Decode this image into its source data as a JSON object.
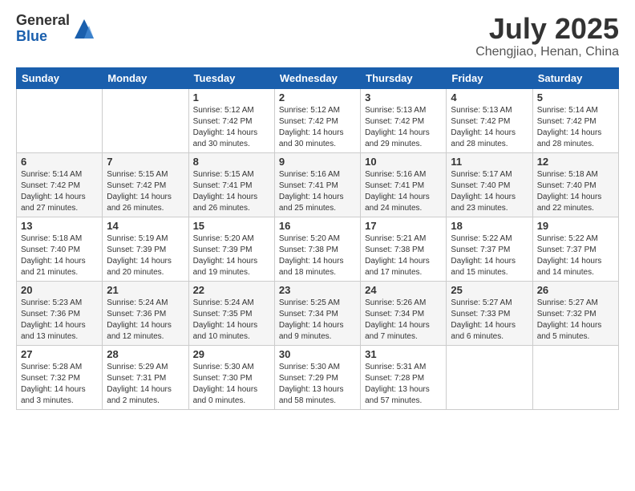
{
  "logo": {
    "general": "General",
    "blue": "Blue"
  },
  "title": "July 2025",
  "subtitle": "Chengjiao, Henan, China",
  "header_days": [
    "Sunday",
    "Monday",
    "Tuesday",
    "Wednesday",
    "Thursday",
    "Friday",
    "Saturday"
  ],
  "weeks": [
    [
      {
        "day": "",
        "info": ""
      },
      {
        "day": "",
        "info": ""
      },
      {
        "day": "1",
        "info": "Sunrise: 5:12 AM\nSunset: 7:42 PM\nDaylight: 14 hours\nand 30 minutes."
      },
      {
        "day": "2",
        "info": "Sunrise: 5:12 AM\nSunset: 7:42 PM\nDaylight: 14 hours\nand 30 minutes."
      },
      {
        "day": "3",
        "info": "Sunrise: 5:13 AM\nSunset: 7:42 PM\nDaylight: 14 hours\nand 29 minutes."
      },
      {
        "day": "4",
        "info": "Sunrise: 5:13 AM\nSunset: 7:42 PM\nDaylight: 14 hours\nand 28 minutes."
      },
      {
        "day": "5",
        "info": "Sunrise: 5:14 AM\nSunset: 7:42 PM\nDaylight: 14 hours\nand 28 minutes."
      }
    ],
    [
      {
        "day": "6",
        "info": "Sunrise: 5:14 AM\nSunset: 7:42 PM\nDaylight: 14 hours\nand 27 minutes."
      },
      {
        "day": "7",
        "info": "Sunrise: 5:15 AM\nSunset: 7:42 PM\nDaylight: 14 hours\nand 26 minutes."
      },
      {
        "day": "8",
        "info": "Sunrise: 5:15 AM\nSunset: 7:41 PM\nDaylight: 14 hours\nand 26 minutes."
      },
      {
        "day": "9",
        "info": "Sunrise: 5:16 AM\nSunset: 7:41 PM\nDaylight: 14 hours\nand 25 minutes."
      },
      {
        "day": "10",
        "info": "Sunrise: 5:16 AM\nSunset: 7:41 PM\nDaylight: 14 hours\nand 24 minutes."
      },
      {
        "day": "11",
        "info": "Sunrise: 5:17 AM\nSunset: 7:40 PM\nDaylight: 14 hours\nand 23 minutes."
      },
      {
        "day": "12",
        "info": "Sunrise: 5:18 AM\nSunset: 7:40 PM\nDaylight: 14 hours\nand 22 minutes."
      }
    ],
    [
      {
        "day": "13",
        "info": "Sunrise: 5:18 AM\nSunset: 7:40 PM\nDaylight: 14 hours\nand 21 minutes."
      },
      {
        "day": "14",
        "info": "Sunrise: 5:19 AM\nSunset: 7:39 PM\nDaylight: 14 hours\nand 20 minutes."
      },
      {
        "day": "15",
        "info": "Sunrise: 5:20 AM\nSunset: 7:39 PM\nDaylight: 14 hours\nand 19 minutes."
      },
      {
        "day": "16",
        "info": "Sunrise: 5:20 AM\nSunset: 7:38 PM\nDaylight: 14 hours\nand 18 minutes."
      },
      {
        "day": "17",
        "info": "Sunrise: 5:21 AM\nSunset: 7:38 PM\nDaylight: 14 hours\nand 17 minutes."
      },
      {
        "day": "18",
        "info": "Sunrise: 5:22 AM\nSunset: 7:37 PM\nDaylight: 14 hours\nand 15 minutes."
      },
      {
        "day": "19",
        "info": "Sunrise: 5:22 AM\nSunset: 7:37 PM\nDaylight: 14 hours\nand 14 minutes."
      }
    ],
    [
      {
        "day": "20",
        "info": "Sunrise: 5:23 AM\nSunset: 7:36 PM\nDaylight: 14 hours\nand 13 minutes."
      },
      {
        "day": "21",
        "info": "Sunrise: 5:24 AM\nSunset: 7:36 PM\nDaylight: 14 hours\nand 12 minutes."
      },
      {
        "day": "22",
        "info": "Sunrise: 5:24 AM\nSunset: 7:35 PM\nDaylight: 14 hours\nand 10 minutes."
      },
      {
        "day": "23",
        "info": "Sunrise: 5:25 AM\nSunset: 7:34 PM\nDaylight: 14 hours\nand 9 minutes."
      },
      {
        "day": "24",
        "info": "Sunrise: 5:26 AM\nSunset: 7:34 PM\nDaylight: 14 hours\nand 7 minutes."
      },
      {
        "day": "25",
        "info": "Sunrise: 5:27 AM\nSunset: 7:33 PM\nDaylight: 14 hours\nand 6 minutes."
      },
      {
        "day": "26",
        "info": "Sunrise: 5:27 AM\nSunset: 7:32 PM\nDaylight: 14 hours\nand 5 minutes."
      }
    ],
    [
      {
        "day": "27",
        "info": "Sunrise: 5:28 AM\nSunset: 7:32 PM\nDaylight: 14 hours\nand 3 minutes."
      },
      {
        "day": "28",
        "info": "Sunrise: 5:29 AM\nSunset: 7:31 PM\nDaylight: 14 hours\nand 2 minutes."
      },
      {
        "day": "29",
        "info": "Sunrise: 5:30 AM\nSunset: 7:30 PM\nDaylight: 14 hours\nand 0 minutes."
      },
      {
        "day": "30",
        "info": "Sunrise: 5:30 AM\nSunset: 7:29 PM\nDaylight: 13 hours\nand 58 minutes."
      },
      {
        "day": "31",
        "info": "Sunrise: 5:31 AM\nSunset: 7:28 PM\nDaylight: 13 hours\nand 57 minutes."
      },
      {
        "day": "",
        "info": ""
      },
      {
        "day": "",
        "info": ""
      }
    ]
  ]
}
